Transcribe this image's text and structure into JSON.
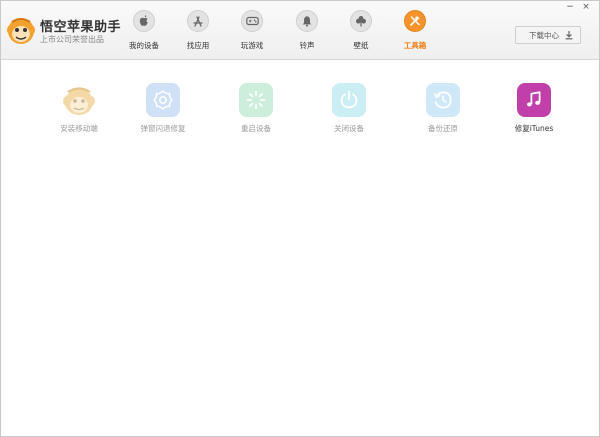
{
  "app": {
    "title": "悟空苹果助手",
    "subtitle": "上市公司荣誉出品"
  },
  "window_controls": {
    "minimize": "−",
    "close": "×"
  },
  "nav": {
    "items": [
      {
        "label": "我的设备",
        "icon": "apple-icon"
      },
      {
        "label": "找应用",
        "icon": "app-store-icon"
      },
      {
        "label": "玩游戏",
        "icon": "gamepad-icon"
      },
      {
        "label": "铃声",
        "icon": "bell-icon"
      },
      {
        "label": "壁纸",
        "icon": "clover-icon"
      },
      {
        "label": "工具箱",
        "icon": "tools-icon",
        "active": true
      }
    ]
  },
  "download": {
    "label": "下载中心"
  },
  "tools": [
    {
      "label": "安装移动端",
      "icon": "monkey-icon",
      "color": "#f3d9a8"
    },
    {
      "label": "弹窗闪退修复",
      "icon": "flower-gear-icon",
      "color": "#cfe0f7"
    },
    {
      "label": "重启设备",
      "icon": "spinner-icon",
      "color": "#cdeedb"
    },
    {
      "label": "关闭设备",
      "icon": "power-icon",
      "color": "#cbeef5"
    },
    {
      "label": "备份还原",
      "icon": "clock-restore-icon",
      "color": "#cfe8f7"
    },
    {
      "label": "修复iTunes",
      "icon": "music-note-icon",
      "color": "#c03fa8",
      "enabled": true
    }
  ],
  "colors": {
    "accent": "#f6932b",
    "active_label": "#ee7d15"
  }
}
